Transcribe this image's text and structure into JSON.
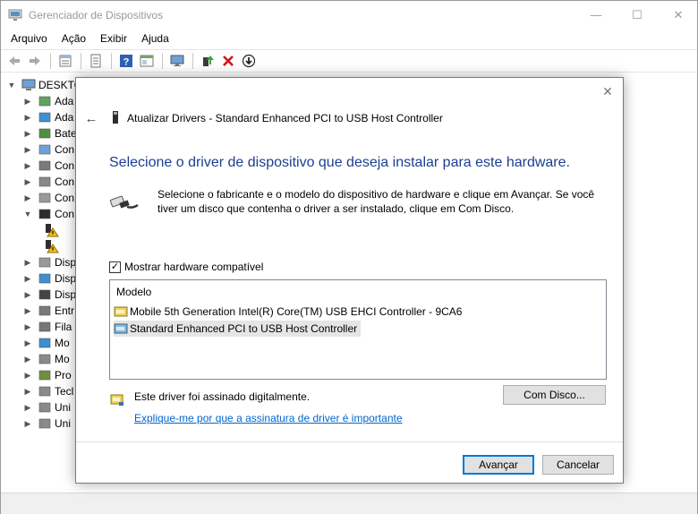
{
  "window": {
    "title": "Gerenciador de Dispositivos",
    "controls": {
      "minimize": "—",
      "maximize": "☐",
      "close": "✕"
    }
  },
  "menu": [
    "Arquivo",
    "Ação",
    "Exibir",
    "Ajuda"
  ],
  "toolbar": {
    "icons": [
      "back-arrow-icon",
      "forward-arrow-icon",
      "properties-icon",
      "list-icon",
      "help-icon",
      "view-icon",
      "monitor-icon",
      "update-driver-icon",
      "uninstall-icon",
      "disable-icon"
    ]
  },
  "tree": {
    "root": "DESKTO",
    "items": [
      {
        "label": "Ada",
        "expanded": false,
        "icon": "audio-icon"
      },
      {
        "label": "Ada",
        "expanded": false,
        "icon": "network-adapter-icon"
      },
      {
        "label": "Bate",
        "expanded": false,
        "icon": "battery-icon"
      },
      {
        "label": "Con",
        "expanded": false,
        "icon": "computer-icon"
      },
      {
        "label": "Con",
        "expanded": false,
        "icon": "controller-icon"
      },
      {
        "label": "Con",
        "expanded": false,
        "icon": "sound-controller-icon"
      },
      {
        "label": "Con",
        "expanded": false,
        "icon": "storage-controller-icon"
      },
      {
        "label": "Con",
        "expanded": true,
        "icon": "usb-icon"
      },
      {
        "label": "",
        "expanded": null,
        "icon": "warning-icon"
      },
      {
        "label": "",
        "expanded": null,
        "icon": "warning-icon"
      },
      {
        "label": "Disp",
        "expanded": false,
        "icon": "disk-icon"
      },
      {
        "label": "Disp",
        "expanded": false,
        "icon": "display-icon"
      },
      {
        "label": "Disp",
        "expanded": false,
        "icon": "portable-icon"
      },
      {
        "label": "Entr",
        "expanded": false,
        "icon": "input-icon"
      },
      {
        "label": "Fila",
        "expanded": false,
        "icon": "print-queue-icon"
      },
      {
        "label": "Mo",
        "expanded": false,
        "icon": "monitor-icon"
      },
      {
        "label": "Mo",
        "expanded": false,
        "icon": "mouse-icon"
      },
      {
        "label": "Pro",
        "expanded": false,
        "icon": "processor-icon"
      },
      {
        "label": "Tecl",
        "expanded": false,
        "icon": "keyboard-icon"
      },
      {
        "label": "Uni",
        "expanded": false,
        "icon": "drive-icon"
      },
      {
        "label": "Uni",
        "expanded": false,
        "icon": "cdrom-icon"
      }
    ]
  },
  "dialog": {
    "close": "✕",
    "back": "←",
    "title": "Atualizar Drivers - Standard Enhanced PCI to USB Host Controller",
    "heading": "Selecione o driver de dispositivo que deseja instalar para este hardware.",
    "description": "Selecione o fabricante e o modelo do dispositivo de hardware e clique em Avançar. Se você tiver um disco que contenha o driver a ser instalado, clique em Com Disco.",
    "checkbox": {
      "label": "Mostrar hardware compatível",
      "checked": true,
      "mark": "✓"
    },
    "model_list": {
      "header": "Modelo",
      "items": [
        {
          "label": "Mobile 5th Generation Intel(R) Core(TM) USB EHCI Controller - 9CA6",
          "selected": false
        },
        {
          "label": "Standard Enhanced PCI to USB Host Controller",
          "selected": true
        }
      ]
    },
    "signed_text": "Este driver foi assinado digitalmente.",
    "signed_link": "Explique-me por que a assinatura de driver é importante",
    "buttons": {
      "have_disk": "Com Disco...",
      "next": "Avançar",
      "cancel": "Cancelar"
    }
  },
  "colors": {
    "heading": "#1b3f91",
    "link": "#0066cc",
    "accent": "#0078d7"
  }
}
